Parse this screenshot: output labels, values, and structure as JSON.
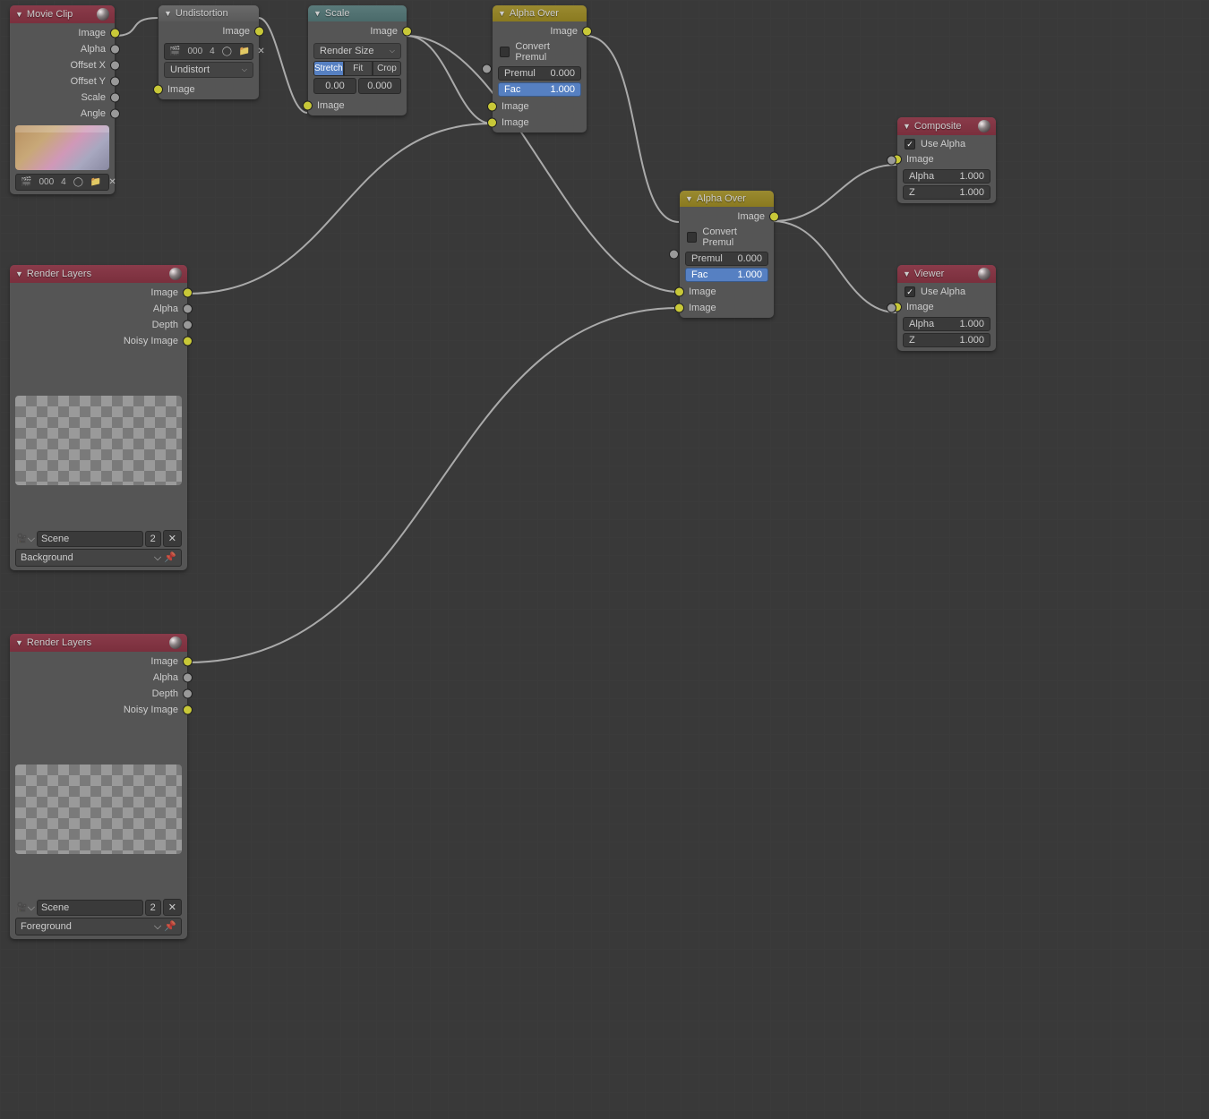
{
  "movieClip": {
    "title": "Movie Clip",
    "outputs": [
      "Image",
      "Alpha",
      "Offset X",
      "Offset Y",
      "Scale",
      "Angle"
    ],
    "clipNum": "000",
    "clipLayer": "4"
  },
  "undistortion": {
    "title": "Undistortion",
    "outImage": "Image",
    "clipNum": "000",
    "clipLayer": "4",
    "mode": "Undistort",
    "inImage": "Image"
  },
  "scale": {
    "title": "Scale",
    "outImage": "Image",
    "mode": "Render Size",
    "b1": "Stretch",
    "b2": "Fit",
    "b3": "Crop",
    "x": "0.00",
    "y": "0.000",
    "inImage": "Image"
  },
  "alphaOver1": {
    "title": "Alpha Over",
    "outImage": "Image",
    "convert": "Convert Premul",
    "premulLabel": "Premul",
    "premulVal": "0.000",
    "facLabel": "Fac",
    "facVal": "1.000",
    "in1": "Image",
    "in2": "Image"
  },
  "alphaOver2": {
    "title": "Alpha Over",
    "outImage": "Image",
    "convert": "Convert Premul",
    "premulLabel": "Premul",
    "premulVal": "0.000",
    "facLabel": "Fac",
    "facVal": "1.000",
    "in1": "Image",
    "in2": "Image"
  },
  "composite": {
    "title": "Composite",
    "useAlpha": "Use Alpha",
    "image": "Image",
    "alphaLabel": "Alpha",
    "alphaVal": "1.000",
    "zLabel": "Z",
    "zVal": "1.000"
  },
  "viewer": {
    "title": "Viewer",
    "useAlpha": "Use Alpha",
    "image": "Image",
    "alphaLabel": "Alpha",
    "alphaVal": "1.000",
    "zLabel": "Z",
    "zVal": "1.000"
  },
  "renderLayers1": {
    "title": "Render Layers",
    "outputs": [
      "Image",
      "Alpha",
      "Depth",
      "Noisy Image"
    ],
    "scene": "Scene",
    "sceneNum": "2",
    "layer": "Background"
  },
  "renderLayers2": {
    "title": "Render Layers",
    "outputs": [
      "Image",
      "Alpha",
      "Depth",
      "Noisy Image"
    ],
    "scene": "Scene",
    "sceneNum": "2",
    "layer": "Foreground"
  }
}
